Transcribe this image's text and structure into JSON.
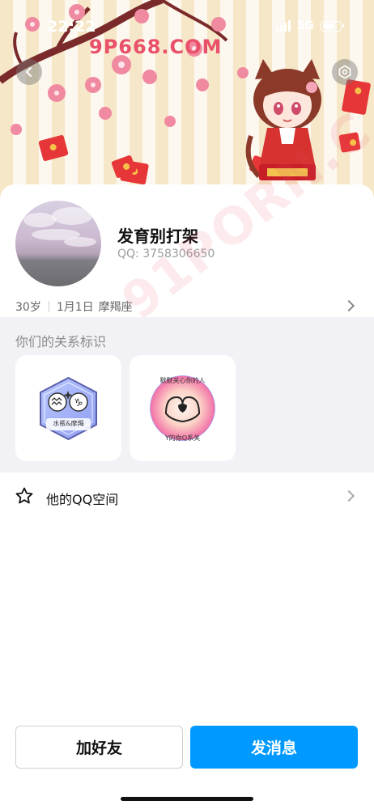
{
  "status_bar": {
    "time": "22:22",
    "network": "5G"
  },
  "banner": {
    "watermark": "9P668.COM",
    "watermark2": "91PORN.C"
  },
  "profile": {
    "nickname": "发育别打架",
    "qq_label": "QQ:",
    "qq_number": "3758306650",
    "age": "30岁",
    "birthday": "1月1日",
    "zodiac": "摩羯座"
  },
  "relation": {
    "title": "你们的关系标识",
    "badges": [
      {
        "label": "水瓶&摩羯"
      },
      {
        "top_text": "默默关心你的人",
        "bottom_text": "Y的你Q系关"
      }
    ]
  },
  "qzone": {
    "label": "他的QQ空间"
  },
  "actions": {
    "add_friend": "加好友",
    "send_message": "发消息"
  },
  "colors": {
    "primary": "#0099ff",
    "relation_bg": "#f2f2f6"
  }
}
